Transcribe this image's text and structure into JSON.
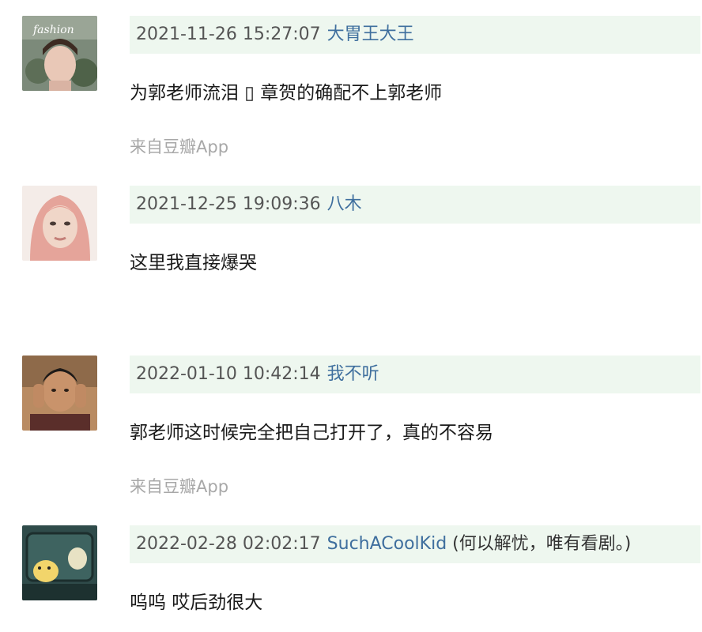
{
  "comments": [
    {
      "timestamp": "2021-11-26 15:27:07",
      "username": "大胃王大王",
      "status": "",
      "content": "为郭老师流泪 ▯ 章贺的确配不上郭老师",
      "source": "来自豆瓣App"
    },
    {
      "timestamp": "2021-12-25 19:09:36",
      "username": "八木",
      "status": "",
      "content": "这里我直接爆哭",
      "source": ""
    },
    {
      "timestamp": "2022-01-10 10:42:14",
      "username": "我不听",
      "status": "",
      "content": "郭老师这时候完全把自己打开了，真的不容易",
      "source": "来自豆瓣App"
    },
    {
      "timestamp": "2022-02-28 02:02:17",
      "username": "SuchACoolKid",
      "status": "(何以解忧，唯有看剧。)",
      "content": "呜呜 哎后劲很大",
      "source": ""
    }
  ]
}
